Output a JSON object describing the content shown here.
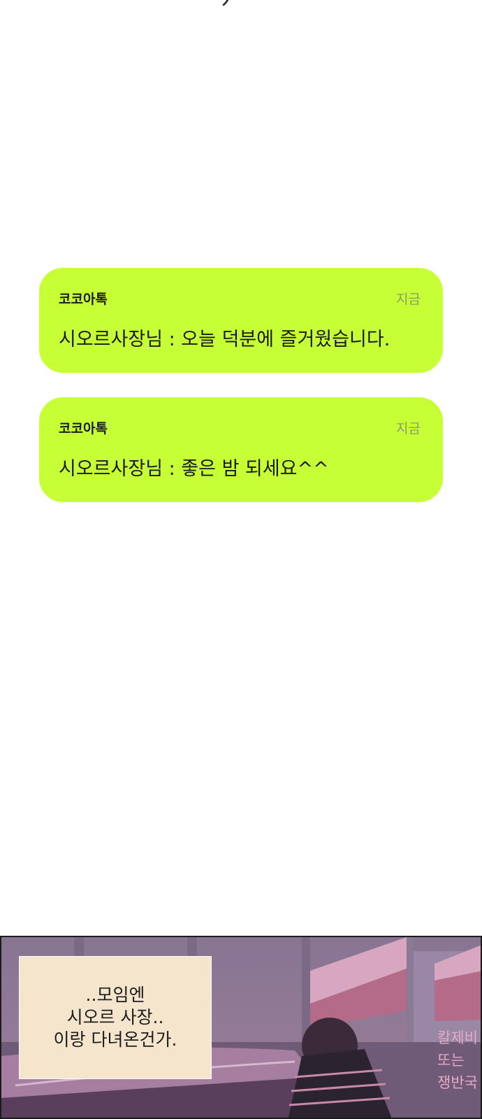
{
  "notifications": [
    {
      "app": "코코아톡",
      "time": "지금",
      "message": "시오르사장님 : 오늘 덕분에 즐거웠습니다."
    },
    {
      "app": "코코아톡",
      "time": "지금",
      "message": "시오르사장님 : 좋은 밤 되세요^^"
    }
  ],
  "panel": {
    "caption_lines": [
      "..모임엔",
      "시오르 사장..",
      "이랑 다녀온건가."
    ],
    "sign_lines": [
      "칼제비",
      "또는",
      "쟁반국"
    ]
  }
}
